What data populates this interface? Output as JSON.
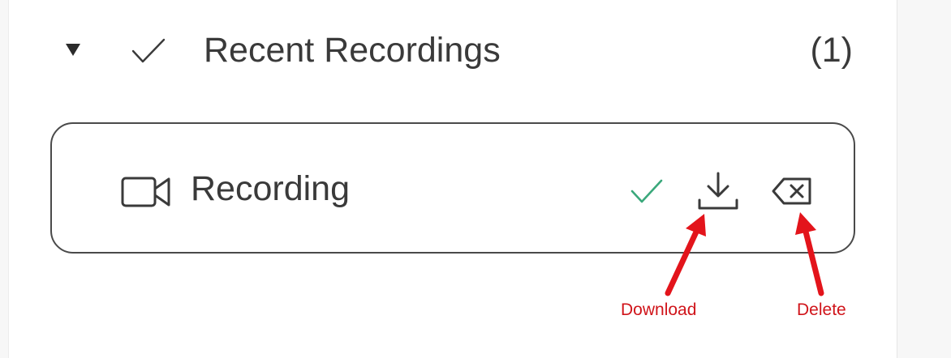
{
  "section": {
    "title": "Recent Recordings",
    "count": "(1)"
  },
  "recording": {
    "label": "Recording",
    "status": "complete"
  },
  "annotations": {
    "download": "Download",
    "delete": "Delete"
  },
  "icons": {
    "collapse": "collapse-triangle-icon",
    "header_check": "checkmark-icon",
    "camera": "video-camera-icon",
    "status_check": "checkmark-icon",
    "download": "download-icon",
    "delete": "backspace-delete-icon"
  },
  "colors": {
    "status_check": "#3aa87b",
    "annotation": "#d0141a",
    "text": "#3a3a3a"
  }
}
